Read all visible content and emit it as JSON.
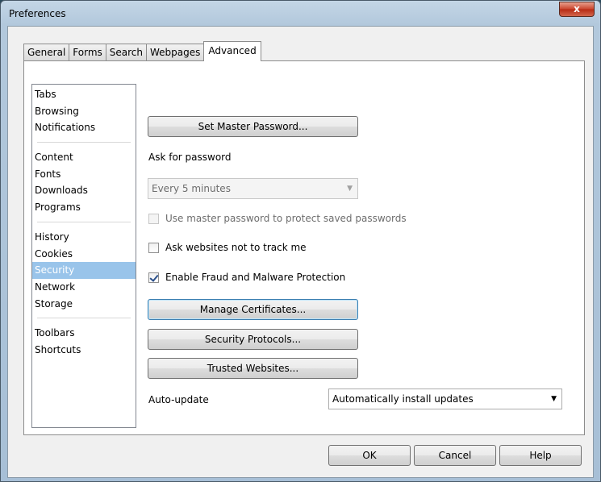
{
  "window": {
    "title": "Preferences",
    "close_glyph": "x"
  },
  "tabs": [
    "General",
    "Forms",
    "Search",
    "Webpages",
    "Advanced"
  ],
  "categories": [
    [
      "Tabs",
      "Browsing",
      "Notifications"
    ],
    [
      "Content",
      "Fonts",
      "Downloads",
      "Programs"
    ],
    [
      "History",
      "Cookies",
      "Security",
      "Network",
      "Storage"
    ],
    [
      "Toolbars",
      "Shortcuts"
    ]
  ],
  "selected_category": "Security",
  "security": {
    "set_master_password": "Set Master Password...",
    "ask_for_password_label": "Ask for password",
    "ask_for_password_value": "Every 5 minutes",
    "use_master_password": "Use master password to protect saved passwords",
    "do_not_track": "Ask websites not to track me",
    "fraud_protection": "Enable Fraud and Malware Protection",
    "manage_certificates": "Manage Certificates...",
    "security_protocols": "Security Protocols...",
    "trusted_websites": "Trusted Websites...",
    "auto_update_label": "Auto-update",
    "auto_update_value": "Automatically install updates"
  },
  "checkbox_states": {
    "use_master_password": false,
    "do_not_track": false,
    "fraud_protection": true
  },
  "buttons": {
    "ok": "OK",
    "cancel": "Cancel",
    "help": "Help"
  },
  "colors": {
    "selection": "#99c4ea",
    "close": "#c9432b"
  }
}
